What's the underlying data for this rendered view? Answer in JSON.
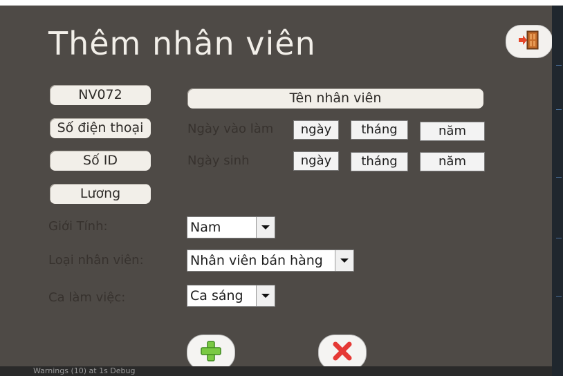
{
  "title": "Thêm nhân viên",
  "fields": {
    "employee_id": "NV072",
    "employee_name": "Tên nhân viên",
    "phone": "Số điện thoại",
    "id_number": "Số ID",
    "salary": "Lương"
  },
  "dates": {
    "join_label": "Ngày vào làm",
    "birth_label": "Ngày sinh",
    "day": "ngày",
    "month": "tháng",
    "year": "năm"
  },
  "selects": {
    "gender_label": "Giới Tính:",
    "gender_value": "Nam",
    "type_label": "Loại nhân viên:",
    "type_value": "Nhân viên bán hàng",
    "shift_label": "Ca làm việc:",
    "shift_value": "Ca sáng"
  },
  "icons": {
    "exit": "exit-door-icon",
    "add": "plus-icon",
    "cancel": "close-icon"
  },
  "colors": {
    "background": "#4e4a46",
    "add_green": "#7ac943",
    "cancel_red": "#e53935"
  },
  "status_bar": "Warnings (10) at 1s Debug"
}
